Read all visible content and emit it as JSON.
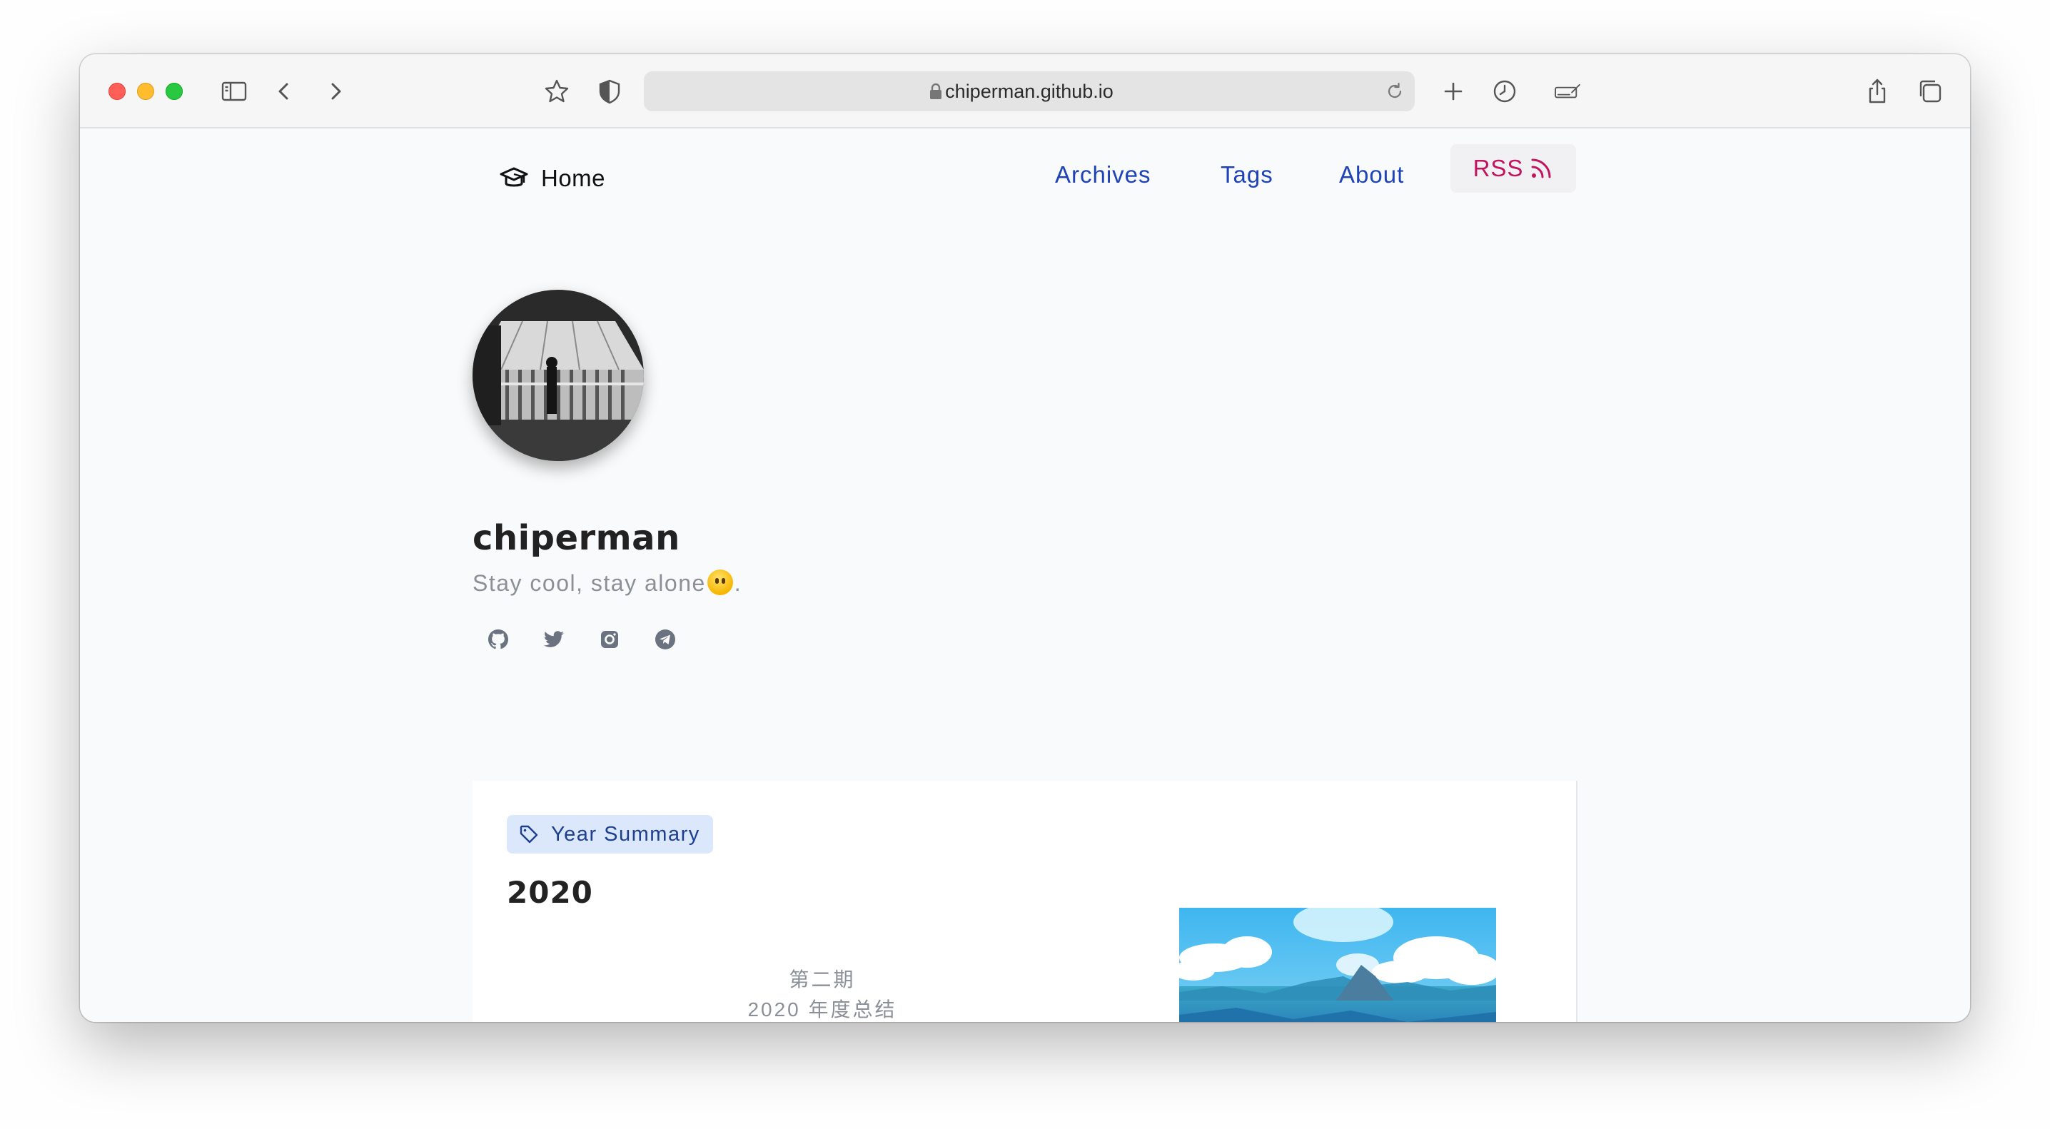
{
  "browser": {
    "url": "chiperman.github.io"
  },
  "nav": {
    "home": "Home",
    "links": [
      "Archives",
      "Tags",
      "About"
    ],
    "rss": "RSS"
  },
  "profile": {
    "name": "chiperman",
    "bio_before": "Stay cool, stay alone",
    "bio_after": ".",
    "socials": [
      "github-icon",
      "twitter-icon",
      "instagram-icon",
      "telegram-icon"
    ]
  },
  "post": {
    "tag": "Year Summary",
    "title": "2020",
    "excerpt_line1": "第二期",
    "excerpt_line2": "2020 年度总结"
  },
  "colors": {
    "link": "#1e43b8",
    "rss": "#c4145d",
    "tag_bg": "#dbe8fb",
    "tag_text": "#1e3f8f"
  }
}
